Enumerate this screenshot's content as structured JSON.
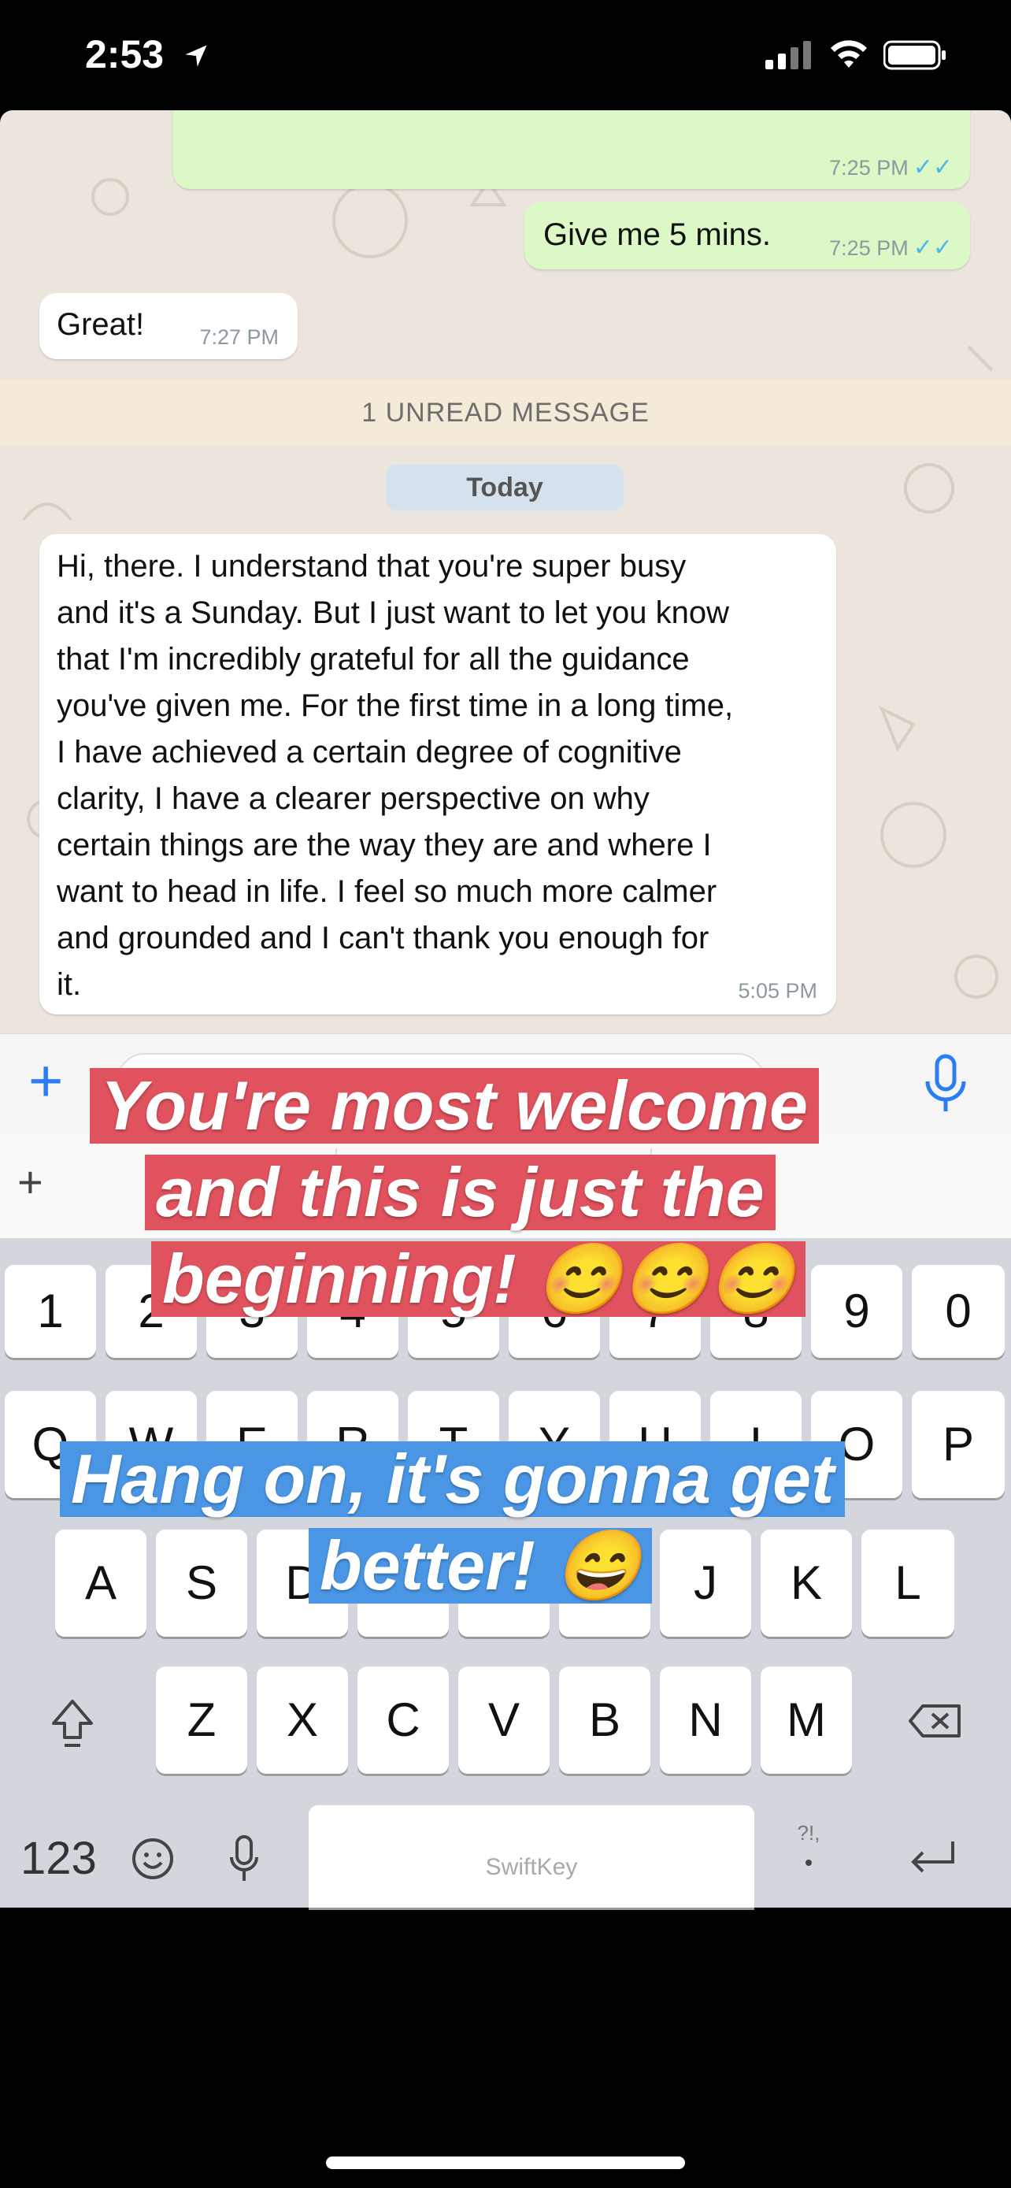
{
  "status_bar": {
    "time": "2:53"
  },
  "chat": {
    "messages": [
      {
        "direction": "out",
        "text": "",
        "time": "7:25 PM",
        "ticks": "✓✓"
      },
      {
        "direction": "out",
        "text": "Give me 5 mins.",
        "time": "7:25 PM",
        "ticks": "✓✓"
      },
      {
        "direction": "in",
        "text": "Great!",
        "time": "7:27 PM"
      }
    ],
    "unread_label": "1 UNREAD MESSAGE",
    "date_label": "Today",
    "long_message": {
      "lines": [
        "Hi, there. I understand that you're super busy",
        "and it's a Sunday. But I just want to let you know",
        "that I'm incredibly grateful for all the guidance",
        "you've given me. For the first time in a long time,",
        "I have achieved a certain degree of cognitive",
        "clarity, I have a clearer perspective on why",
        "certain things are the way they are and where I",
        "want to head in life. I feel so much more calmer",
        "and grounded and I can't thank you enough for",
        "it."
      ],
      "time": "5:05 PM"
    }
  },
  "input_bar": {
    "plus_glyph": "+"
  },
  "keyboard": {
    "suggest_plus": "+",
    "number_row": [
      "1",
      "2",
      "3",
      "4",
      "5",
      "6",
      "7",
      "8",
      "9",
      "0"
    ],
    "row1": [
      "Q",
      "W",
      "E",
      "R",
      "T",
      "Y",
      "U",
      "I",
      "O",
      "P"
    ],
    "row2": [
      "A",
      "S",
      "D",
      "F",
      "G",
      "H",
      "J",
      "K",
      "L"
    ],
    "row3": [
      "Z",
      "X",
      "C",
      "V",
      "B",
      "N",
      "M"
    ],
    "numbers_label": "123",
    "punct_label": "?!,",
    "space_label": "SwiftKey"
  },
  "captions": {
    "red_lines": [
      "You're most welcome",
      "and this is just the",
      "beginning! 😊😊😊"
    ],
    "blue_lines": [
      "Hang on, it's gonna get",
      "better! 😄"
    ]
  },
  "colors": {
    "chat_bg": "#ece5dd",
    "outgoing_bubble": "#dcf8c6",
    "caption_red": "#e0525d",
    "caption_blue": "#4a96e4"
  }
}
